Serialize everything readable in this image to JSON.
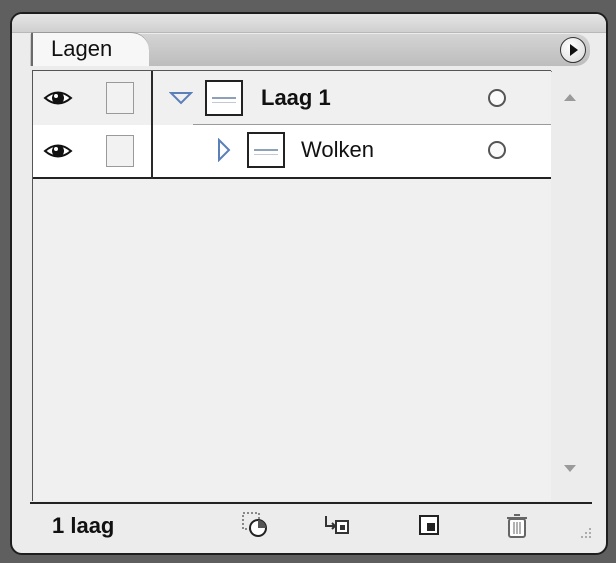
{
  "panel": {
    "tab_label": "Lagen"
  },
  "layers": [
    {
      "name": "Laag 1",
      "expanded": true
    },
    {
      "name": "Wolken",
      "expanded": false
    }
  ],
  "footer": {
    "layer_count": "1 laag"
  },
  "icons": {
    "visibility": "eye-icon",
    "lock": "lock-toggle-icon",
    "expand": "triangle-icon",
    "target": "target-circle-icon",
    "panel_menu": "panel-menu-icon",
    "scroll_up": "arrow-up-icon",
    "scroll_down": "arrow-down-icon",
    "make_clipping_mask": "clipping-mask-icon",
    "new_sublayer": "new-sublayer-icon",
    "new_layer": "new-layer-icon",
    "delete": "trash-icon",
    "resize_grip": "resize-grip-icon"
  },
  "colors": {
    "panel_bg": "#ececec",
    "frame": "#1e1e1e",
    "selected_row": "#ffffff",
    "twisty": "#5b7fb8"
  }
}
